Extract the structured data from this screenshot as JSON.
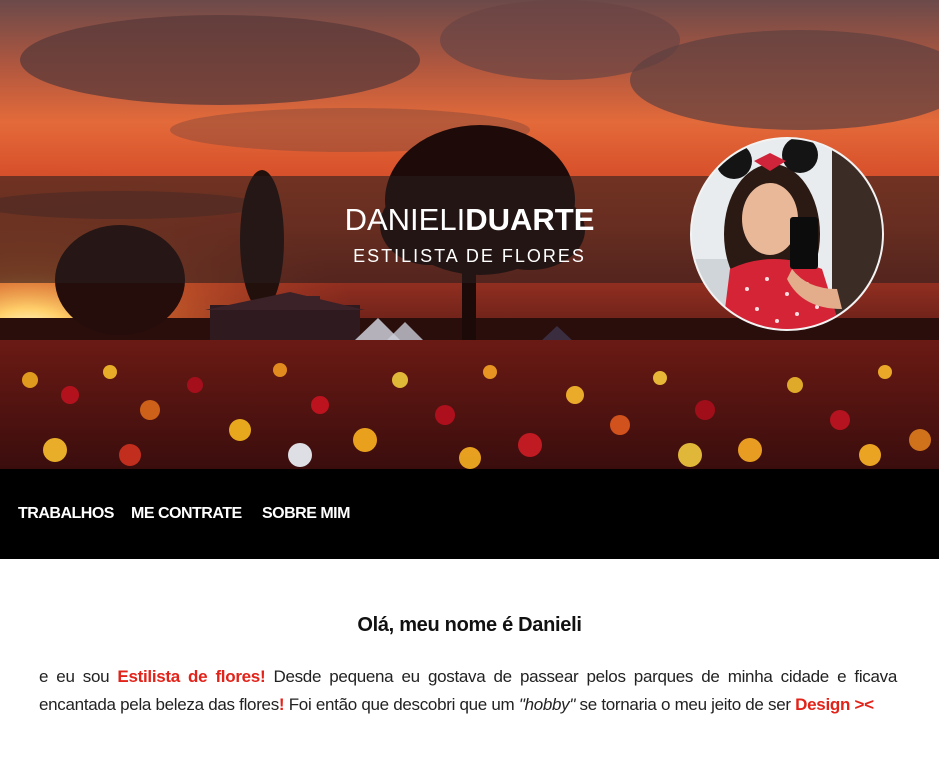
{
  "header": {
    "brand_first": "DANIELI",
    "brand_last": "DUARTE",
    "tagline": "ESTILISTA DE FLORES"
  },
  "nav": {
    "items": [
      "TRABALHOS",
      "ME CONTRATE",
      "SOBRE MIM"
    ]
  },
  "main": {
    "heading": "Olá, meu nome é Danieli",
    "intro_part1": "e eu sou ",
    "intro_highlight1": "Estilista de flores",
    "intro_exclaim1": "!",
    "intro_part2": " Desde pequena eu gostava de passear pelos parques de minha cidade e ficava encantada pela beleza das flores",
    "intro_exclaim2": "!",
    "intro_part3": " Foi então que descobri que um ",
    "intro_hobby": "\"hobby\"",
    "intro_part4": " se tornaria o meu jeito de ser ",
    "intro_highlight2": "Design ><"
  },
  "colors": {
    "accent": "#e2231a",
    "navbar_bg": "#000000",
    "page_bg": "#ffffff"
  }
}
